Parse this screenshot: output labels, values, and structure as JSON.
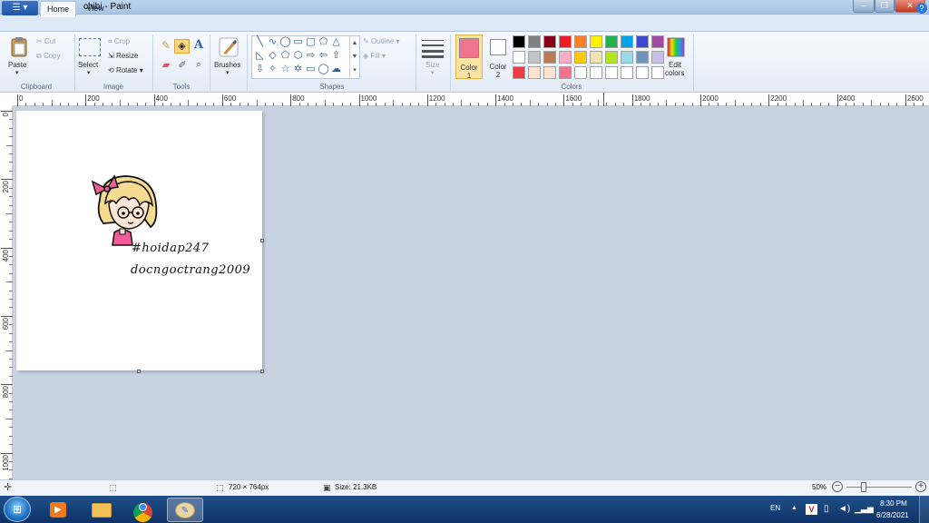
{
  "window": {
    "title": "chibi - Paint"
  },
  "tabs": {
    "file_label": "",
    "home": "Home",
    "view": "View"
  },
  "ribbon": {
    "clipboard": {
      "group": "Clipboard",
      "paste": "Paste",
      "cut": "Cut",
      "copy": "Copy"
    },
    "image": {
      "group": "Image",
      "select": "Select",
      "crop": "Crop",
      "resize": "Resize",
      "rotate": "Rotate"
    },
    "tools": {
      "group": "Tools"
    },
    "brushes": "Brushes",
    "shapes": {
      "group": "Shapes",
      "outline": "Outline",
      "fill": "Fill"
    },
    "size": "Size",
    "colors": {
      "group": "Colors",
      "color1": "Color",
      "color1_num": "1",
      "color2": "Color",
      "color2_num": "2",
      "edit": "Edit",
      "edit2": "colors",
      "color1_value": "#f0738f",
      "color2_value": "#ffffff",
      "palette": [
        "#000000",
        "#7f7f7f",
        "#880015",
        "#ed1c24",
        "#ff7f27",
        "#fff200",
        "#22b14c",
        "#00a2e8",
        "#3f48cc",
        "#a349a4",
        "#ffffff",
        "#c3c3c3",
        "#b97a57",
        "#ffaec9",
        "#ffc90e",
        "#efe4b0",
        "#b5e61d",
        "#99d9ea",
        "#7092be",
        "#c8bfe7",
        "#ed3a45",
        "#fde4d0",
        "#fde4d0",
        "#f0738f",
        "#ffffff",
        "#ffffff",
        "#ffffff",
        "#ffffff",
        "#ffffff",
        "#ffffff"
      ]
    }
  },
  "ruler": {
    "h": [
      "0",
      "200",
      "400",
      "600",
      "800",
      "1000",
      "1200",
      "1400",
      "1600",
      "1800",
      "2000",
      "2200",
      "2400",
      "2600"
    ],
    "v": [
      "0",
      "200",
      "400",
      "600",
      "800",
      "1000"
    ]
  },
  "canvas": {
    "line1": "#hoidap247",
    "line2": "docngoctrang2009"
  },
  "status": {
    "dimensions": "720 × 764px",
    "size": "Size: 21.3KB",
    "zoom": "50%"
  },
  "taskbar": {
    "lang": "EN",
    "time": "8:30 PM",
    "date": "6/28/2021"
  }
}
